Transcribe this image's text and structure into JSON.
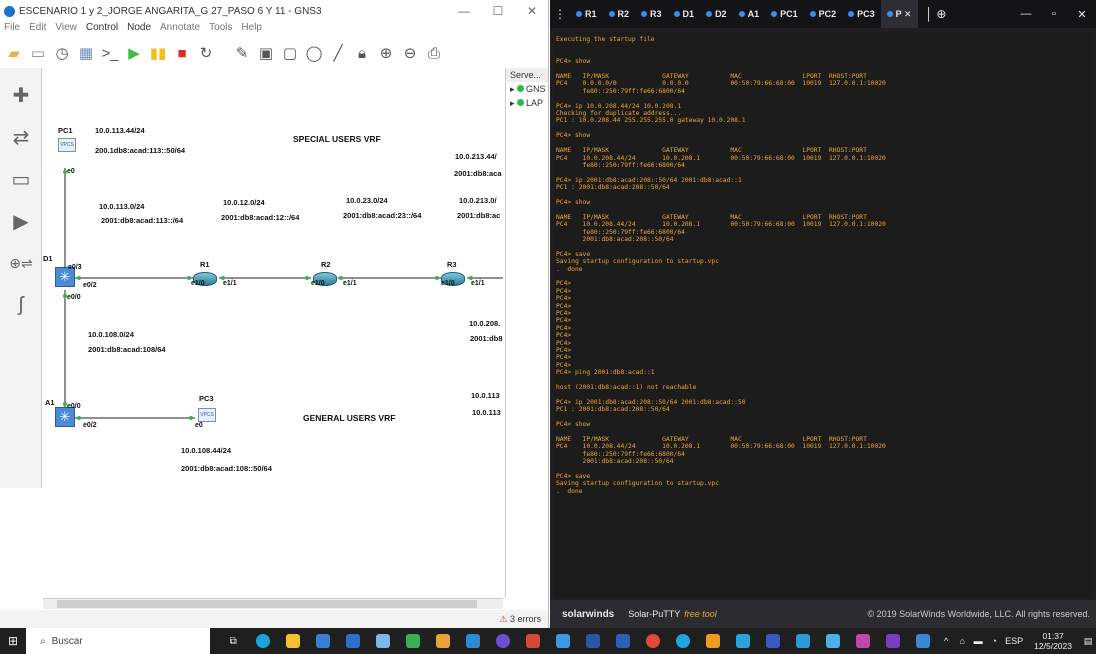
{
  "gns3": {
    "title": "ESCENARIO 1 y 2_JORGE ANGARITA_G 27_PASO 6 Y 11 - GNS3",
    "menu": [
      "File",
      "Edit",
      "View",
      "Control",
      "Node",
      "Annotate",
      "Tools",
      "Help"
    ],
    "topology_panel": {
      "header": "Serve...",
      "items": [
        "GNS",
        "LAP"
      ]
    },
    "status": "3 errors",
    "canvas": {
      "vrf_special": "SPECIAL USERS VRF",
      "vrf_general": "GENERAL USERS VRF",
      "devices": {
        "pc1": "PC1",
        "pc3": "PC3",
        "d1": "D1",
        "a1": "A1",
        "r1": "R1",
        "r2": "R2",
        "r3": "R3"
      },
      "pc1_ipv4": "10.0.113.44/24",
      "pc1_ipv6": "200.1db8:acad:113::50/64",
      "net113_v4": "10.0.113.0/24",
      "net113_v6": "2001:db8:acad:113::/64",
      "net12_v4": "10.0.12.0/24",
      "net12_v6": "2001:db8:acad:12::/64",
      "net23_v4": "10.0.23.0/24",
      "net23_v6": "2001:db8:acad:23::/64",
      "net2132_v4": "10.0.213.0/",
      "net2132_v6": "2001:db8:ac",
      "net213_v4": "10.0.213.44/",
      "net213_v6": "2001:db8:aca",
      "net108_v4": "10.0.108.0/24",
      "net108_v6": "2001:db8:acad:108/64",
      "net208_v4": "10.0.208.",
      "net208_v6": "2001:db8",
      "net113b_v4": "10.0.113",
      "net113c_v4": "10.0.113",
      "pc3_ipv4": "10.0.108.44/24",
      "pc3_ipv6": "2001:db8:acad:108::50/64",
      "ports": {
        "pc1_e0": "e0",
        "d1_e03": "e0/3",
        "d1_e02": "e0/2",
        "d1_e00": "e0/0",
        "r1_e10": "e1/0",
        "r1_e11": "e1/1",
        "r2_e10": "e1/0",
        "r2_e11": "e1/1",
        "r3_e10": "e1/0",
        "r3_e11": "e1/1",
        "a1_e00": "e0/0",
        "a1_e02": "e0/2",
        "pc3_e0": "e0"
      }
    }
  },
  "putty": {
    "tabs": [
      "R1",
      "R2",
      "R3",
      "D1",
      "D2",
      "A1",
      "PC1",
      "PC2",
      "PC3",
      "P"
    ],
    "terminal": "Executing the startup file\n\n\nPC4> show\n\nNAME   IP/MASK              GATEWAY           MAC                LPORT  RHOST:PORT\nPC4    0.0.0.0/0            0.0.0.0           00:50:79:66:68:00  10019  127.0.0.1:10020\n       fe80::250:79ff:fe66:6800/64\n\nPC4> ip 10.0.208.44/24 10.0.208.1\nChecking for duplicate address...\nPC1 : 10.0.208.44 255.255.255.0 gateway 10.0.208.1\n\nPC4> show\n\nNAME   IP/MASK              GATEWAY           MAC                LPORT  RHOST:PORT\nPC4    10.0.208.44/24       10.0.208.1        00:50:79:66:68:00  10019  127.0.0.1:10020\n       fe80::250:79ff:fe66:6800/64\n\nPC4> ip 2001:db8:acad:208::50/64 2001:db8:acad::1\nPC1 : 2001:db8:acad:208::50/64\n\nPC4> show\n\nNAME   IP/MASK              GATEWAY           MAC                LPORT  RHOST:PORT\nPC4    10.0.208.44/24       10.0.208.1        00:50:79:66:68:00  10019  127.0.0.1:10020\n       fe80::250:79ff:fe66:6800/64\n       2001:db8:acad:208::50/64\n\nPC4> save\nSaving startup configuration to startup.vpc\n.  done\n\nPC4>\nPC4>\nPC4>\nPC4>\nPC4>\nPC4>\nPC4>\nPC4>\nPC4>\nPC4>\nPC4>\nPC4>\nPC4> ping 2001:db8:acad::1\n\nhost (2001:db8:acad::1) not reachable\n\nPC4> ip 2001:db8:acad:208::50/64 2001:db8:acad::50\nPC1 : 2001:db8:acad:208::50/64\n\nPC4> show\n\nNAME   IP/MASK              GATEWAY           MAC                LPORT  RHOST:PORT\nPC4    10.0.208.44/24       10.0.208.1        00:50:79:66:68:00  10019  127.0.0.1:10020\n       fe80::250:79ff:fe66:6800/64\n       2001:db8:acad:208::50/64\n\nPC4> save\nSaving startup configuration to startup.vpc\n.  done",
    "footer_brand": "solarwinds",
    "footer_product": "Solar-PuTTY",
    "footer_free": "free tool",
    "footer_copy": "© 2019 SolarWinds Worldwide, LLC. All rights reserved."
  },
  "taskbar": {
    "search_placeholder": "Buscar",
    "language": "ESP",
    "time": "01:37",
    "date": "12/5/2023"
  }
}
